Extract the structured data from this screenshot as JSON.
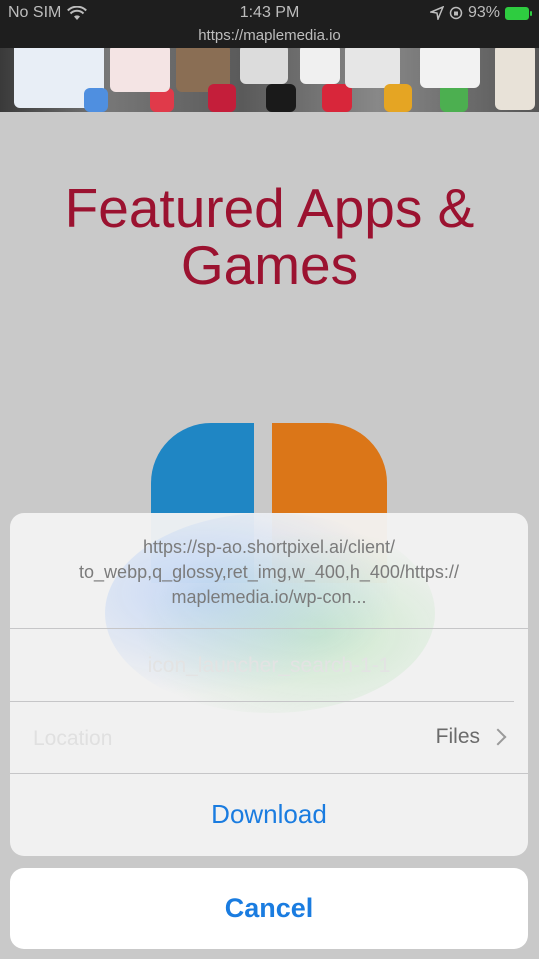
{
  "status_bar": {
    "carrier": "No SIM",
    "time": "1:43 PM",
    "battery": "93%",
    "icons": [
      "wifi-icon",
      "location-icon",
      "orientation-lock-icon",
      "battery-charging-icon"
    ]
  },
  "browser": {
    "url": "https://maplemedia.io"
  },
  "page": {
    "headline_line1": "Featured Apps &",
    "headline_line2": "Games",
    "accent_color": "#9b1230"
  },
  "download_sheet": {
    "url_text": "https://sp-ao.shortpixel.ai/client/ to_webp,q_glossy,ret_img,w_400,h_400/https:// maplemedia.io/wp-con...",
    "filename": "icon_launcher_search-1-1",
    "location_label": "Location",
    "location_value": "Files",
    "download_label": "Download",
    "cancel_label": "Cancel",
    "action_color": "#1a7ce0"
  }
}
